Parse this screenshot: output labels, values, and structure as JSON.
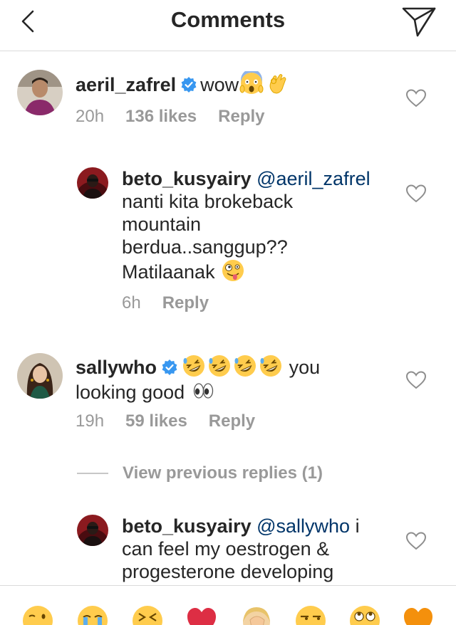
{
  "header": {
    "title": "Comments"
  },
  "comments": [
    {
      "username": "aeril_zafrel",
      "verified": true,
      "text": "wow",
      "emojis": [
        "face-screaming-emoji",
        "ok-hand-emoji"
      ],
      "time": "20h",
      "likes": "136 likes",
      "reply": "Reply"
    },
    {
      "username": "beto_kusyairy",
      "mention": "@aeril_zafrel",
      "text_lines": [
        "nanti kita brokeback",
        "mountain",
        "berdua..sanggup??",
        "Matilaanak"
      ],
      "emojis": [
        "zany-face-emoji"
      ],
      "time": "6h",
      "reply": "Reply"
    },
    {
      "username": "sallywho",
      "verified": true,
      "emojis": [
        "rolling-laughing-emoji",
        "rolling-laughing-emoji",
        "rolling-laughing-emoji",
        "rolling-laughing-emoji"
      ],
      "text_tail": "you",
      "text_line2": "looking good",
      "emojis2": [
        "eyes-emoji"
      ],
      "time": "19h",
      "likes": "59 likes",
      "reply": "Reply"
    },
    {
      "username": "beto_kusyairy",
      "mention": "@sallywho",
      "text_tail": "i",
      "text_lines": [
        "can feel my oestrogen &",
        "progesterone developing"
      ]
    }
  ],
  "view_previous_replies": "View previous replies (1)",
  "emoji_bar": [
    "winking-tongue-emoji",
    "loudly-crying-emoji",
    "squinting-face-emoji",
    "red-heart-emoji",
    "facepalm-emoji",
    "unamused-face-emoji",
    "rolling-eyes-emoji",
    "orange-heart-emoji"
  ],
  "colors": {
    "text": "#262626",
    "meta": "#999999",
    "mention": "#003569",
    "verified": "#3897f0",
    "divider": "#dbdbdb"
  }
}
